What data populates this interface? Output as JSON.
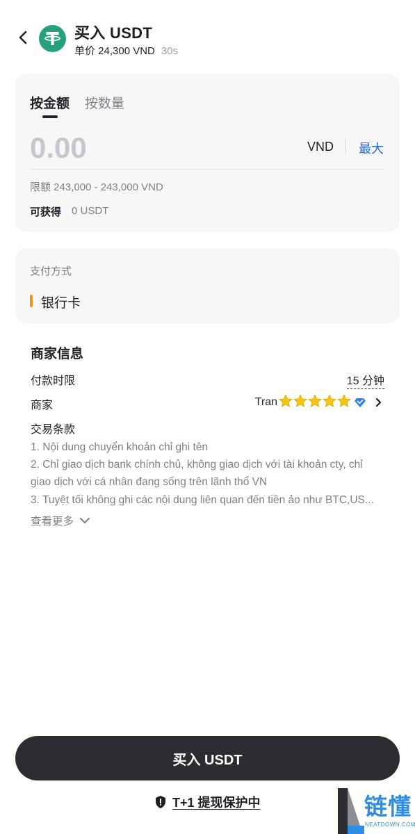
{
  "header": {
    "title": "买入 USDT",
    "price_text": "单价 24,300 VND",
    "timer": "30s"
  },
  "amount_card": {
    "tabs": [
      {
        "label": "按金额",
        "selected": true
      },
      {
        "label": "按数量",
        "selected": false
      }
    ],
    "input_placeholder": "0.00",
    "currency": "VND",
    "max_label": "最大",
    "limit_text": "限额 243,000 - 243,000 VND",
    "receive_label": "可获得",
    "receive_value": "0 USDT"
  },
  "payment": {
    "label": "支付方式",
    "method": "银行卡",
    "method_color": "#f7931a"
  },
  "merchant": {
    "heading": "商家信息",
    "pay_time_label": "付款时限",
    "pay_time_value": "15 分钟",
    "merchant_label": "商家",
    "merchant_name": "Tran",
    "rating_stars": 5,
    "terms_label": "交易条款",
    "terms_lines": [
      "1. Nội dung chuyển khoản chỉ ghi tên",
      "2. Chỉ giao dịch bank chính chủ, không giao dịch với tài khoản cty, chỉ",
      "giao dịch với cá nhân đang sống trên lãnh thổ VN",
      "3. Tuyệt tối không ghi các nội dung liên quan đến tiền ảo như BTC,US..."
    ],
    "show_more": "查看更多"
  },
  "footer": {
    "buy_button": "买入 USDT",
    "protection_text": "T+1 提现保护中"
  },
  "watermark": {
    "text": "链懂",
    "sub": "NEATDOWN.COM"
  },
  "colors": {
    "usdt_green": "#26a17b",
    "link_blue": "#1f6bd9",
    "button_dark": "#2b2d31",
    "star_yellow": "#f5c518",
    "diamond_blue": "#2f7cf6"
  }
}
